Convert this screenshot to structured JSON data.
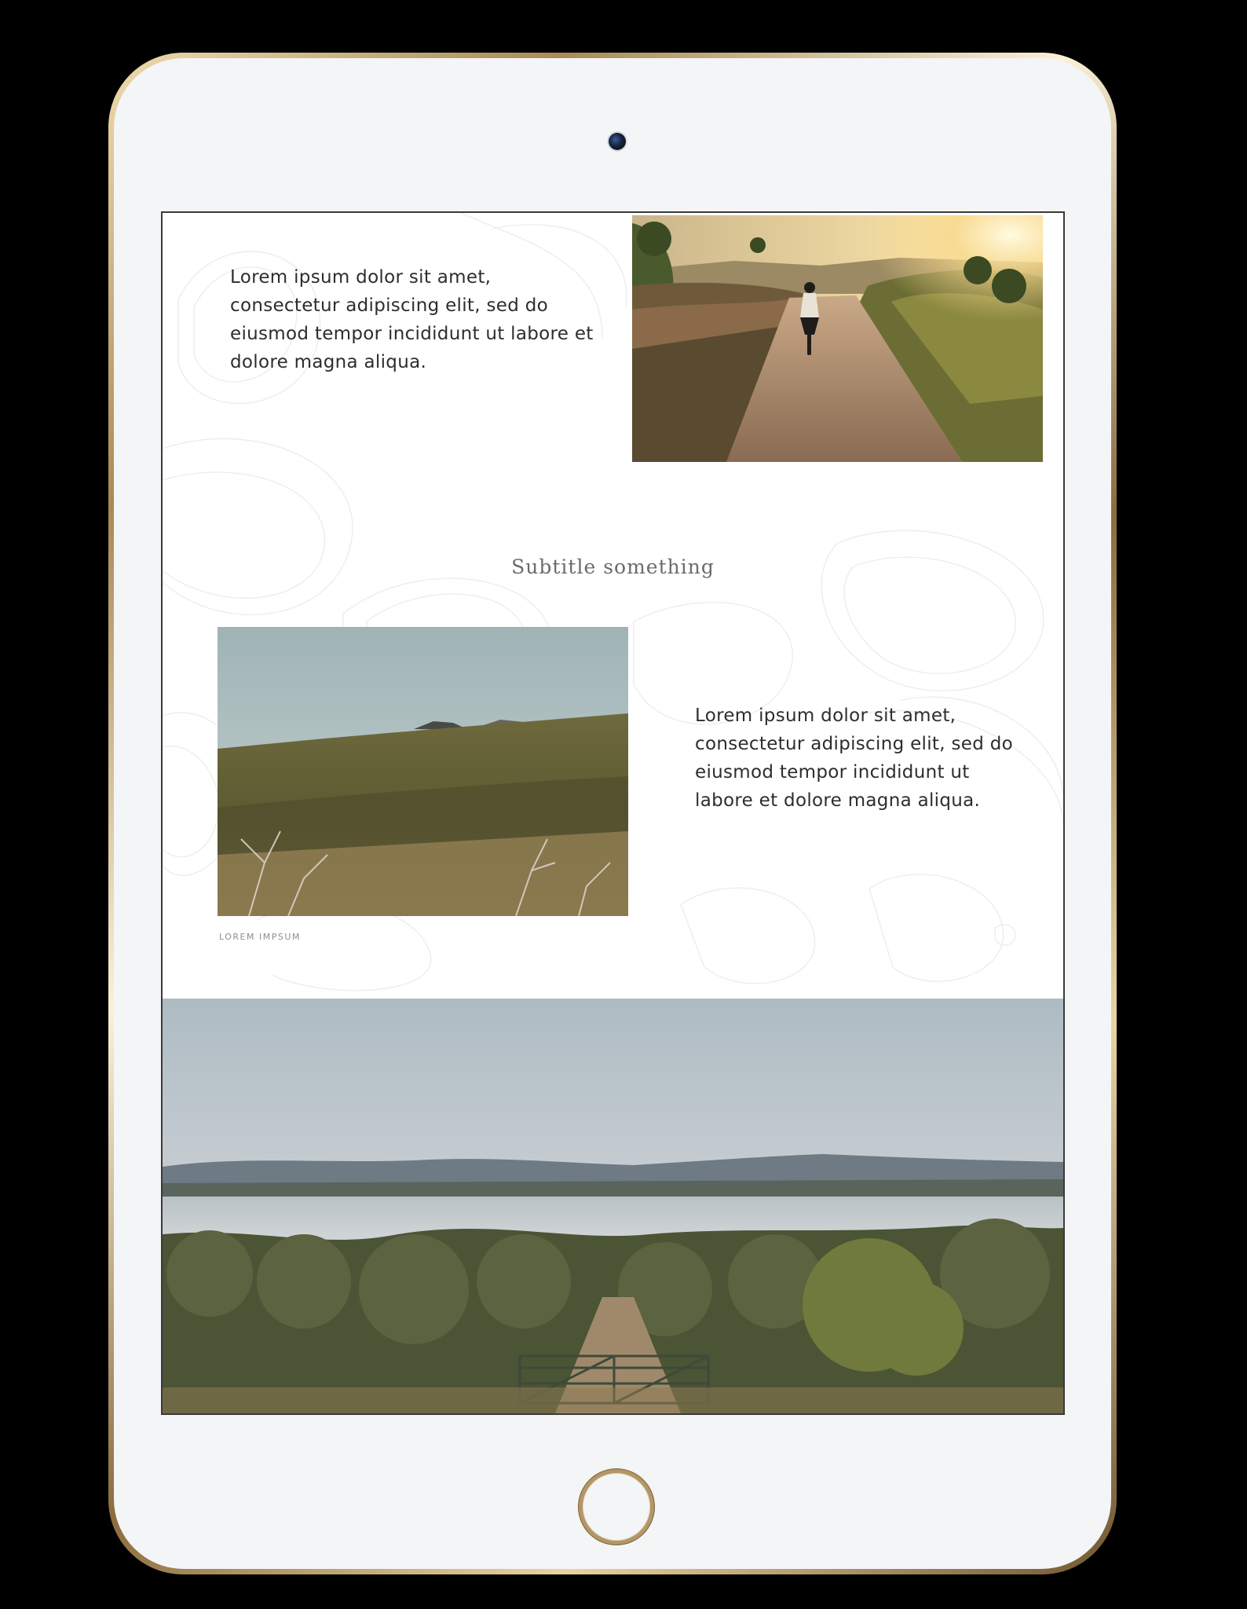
{
  "page": {
    "text_1": "Lorem ipsum dolor sit amet, consectetur adipiscing elit, sed do eiusmod tempor incididunt ut labore et dolore magna aliqua.",
    "subtitle": "Subtitle something",
    "text_2": "Lorem ipsum dolor sit amet, consectetur adipiscing elit, sed do eiusmod tempor incididunt ut labore et dolore magna aliqua.",
    "caption": "Lorem impsum"
  },
  "images": {
    "cyclist": "cyclist-on-gravel-road-photo",
    "meadow": "hillside-meadow-photo",
    "olive_grove": "olive-grove-by-sea-photo"
  },
  "colors": {
    "device_frame": "#c9ad78",
    "screen_background": "#ffffff",
    "body_text": "#2d2d2d",
    "subtitle_text": "#6b6b6b",
    "caption_text": "#8d8d8d"
  }
}
